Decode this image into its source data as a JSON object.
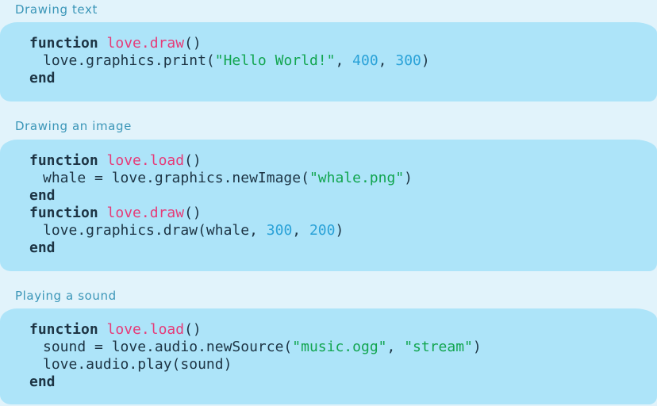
{
  "sections": [
    {
      "title": "Drawing text",
      "lines": [
        {
          "kw": "function",
          "fn": "love.draw",
          "rest": "()"
        },
        {
          "pre": "love.graphics.print(",
          "s1": "\"Hello World!\"",
          "sep1": ", ",
          "n1": "400",
          "sep2": ", ",
          "n2": "300",
          "post": ")"
        },
        {
          "kw": "end"
        }
      ]
    },
    {
      "title": "Drawing an image",
      "lines": [
        {
          "kw": "function",
          "fn": "love.load",
          "rest": "()"
        },
        {
          "pre": "whale = love.graphics.newImage(",
          "s1": "\"whale.png\"",
          "post": ")"
        },
        {
          "kw": "end"
        },
        {
          "kw": "function",
          "fn": "love.draw",
          "rest": "()"
        },
        {
          "pre": "love.graphics.draw(whale, ",
          "n1": "300",
          "sep": ", ",
          "n2": "200",
          "post": ")"
        },
        {
          "kw": "end"
        }
      ]
    },
    {
      "title": "Playing a sound",
      "lines": [
        {
          "kw": "function",
          "fn": "love.load",
          "rest": "()"
        },
        {
          "pre": "sound = love.audio.newSource(",
          "s1": "\"music.ogg\"",
          "sep": ", ",
          "s2": "\"stream\"",
          "post": ")"
        },
        {
          "text": "love.audio.play(sound)"
        },
        {
          "kw": "end"
        }
      ]
    }
  ],
  "colors": {
    "background": "#e1f3fb",
    "code_background": "#ade4f9",
    "heading": "#3b96b8",
    "keyword": "#1d3444",
    "function_name": "#e63b78",
    "string": "#12a550",
    "number": "#2aa2d8"
  }
}
